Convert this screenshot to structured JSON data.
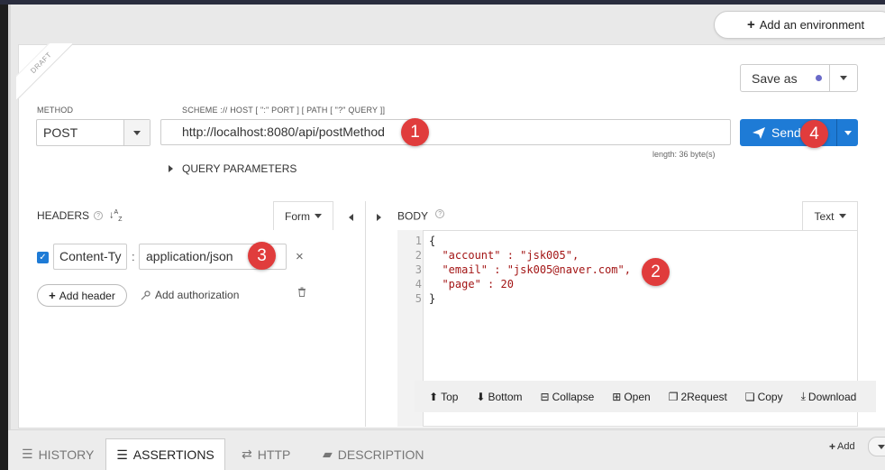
{
  "environment": {
    "add_label": "Add an environment"
  },
  "draft_label": "DRAFT",
  "save": {
    "label": "Save as"
  },
  "method": {
    "label": "METHOD",
    "value": "POST"
  },
  "scheme": {
    "label": "SCHEME :// HOST [ \":\" PORT ] [ PATH [ \"?\" QUERY ]]",
    "url": "http://localhost:8080/api/postMethod",
    "length_text": "length: 36 byte(s)"
  },
  "send": {
    "label": "Send"
  },
  "query_params": {
    "label": "QUERY PARAMETERS"
  },
  "headers": {
    "title": "HEADERS",
    "form_tab": "Form",
    "rows": [
      {
        "enabled": true,
        "name": "Content-Ty",
        "value": "application/json"
      }
    ],
    "add_header_label": "Add header",
    "add_authorization_label": "Add authorization"
  },
  "body": {
    "title": "BODY",
    "format_tab": "Text",
    "line_numbers": [
      "1",
      "2",
      "3",
      "4",
      "5"
    ],
    "lines": [
      "{",
      "  \"account\" : \"jsk005\",",
      "  \"email\" : \"jsk005@naver.com\",",
      "  \"page\" : 20",
      "}"
    ],
    "toolbar": {
      "top": "Top",
      "bottom": "Bottom",
      "collapse": "Collapse",
      "open": "Open",
      "to_request": "2Request",
      "copy": "Copy",
      "download": "Download"
    }
  },
  "badges": {
    "one": "1",
    "two": "2",
    "three": "3",
    "four": "4"
  },
  "bottom_tabs": {
    "history": "HISTORY",
    "assertions": "ASSERTIONS",
    "http": "HTTP",
    "description": "DESCRIPTION",
    "add": "Add"
  },
  "colors": {
    "accent": "#1e7bd6",
    "badge": "#e03c3c",
    "save_dot": "#6a6ac8"
  }
}
